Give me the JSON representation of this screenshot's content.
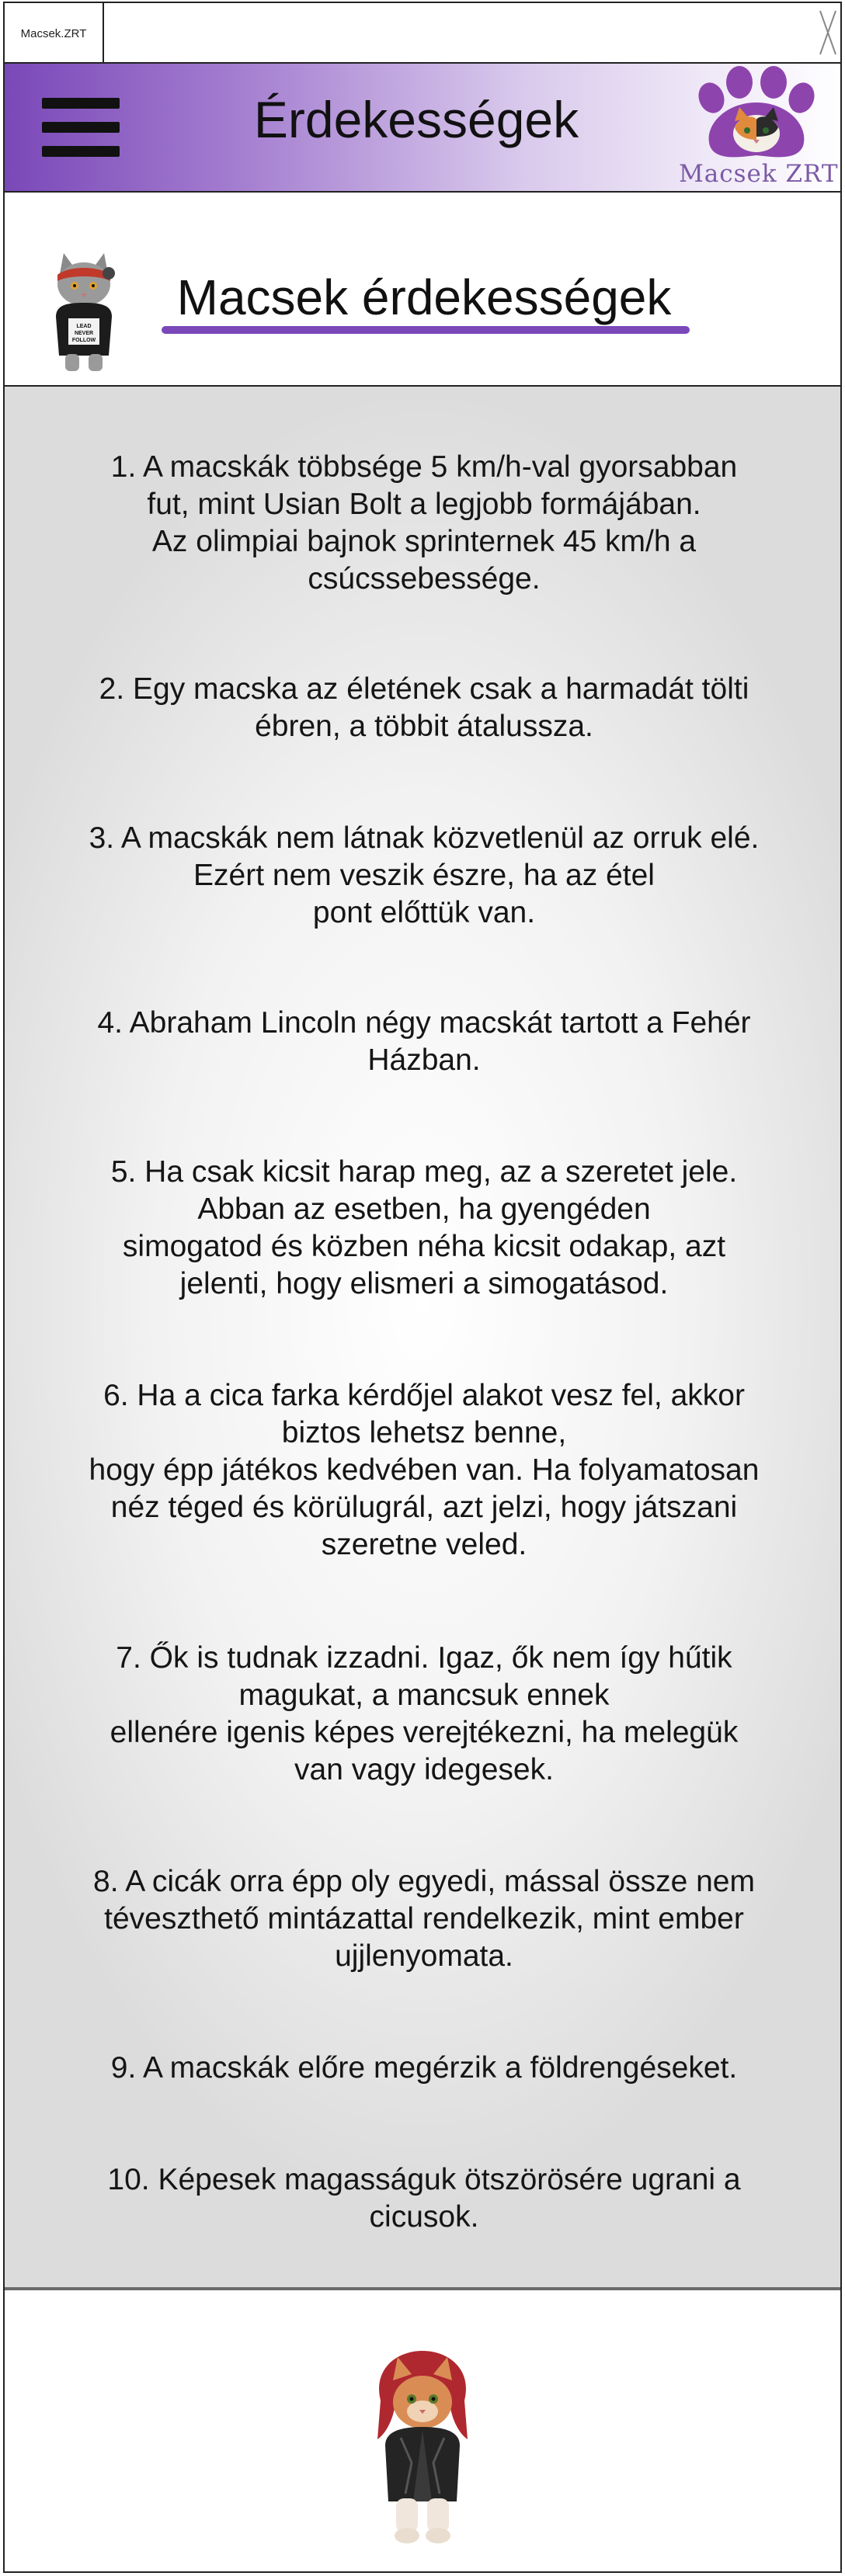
{
  "browser": {
    "tab_label": "Macsek.ZRT"
  },
  "header": {
    "title": "Érdekességek",
    "logo_text": "Macsek ZRT",
    "menu_icon": "hamburger-menu-icon",
    "accent": "#7a48b8"
  },
  "page": {
    "title": "Macsek érdekességek"
  },
  "facts": [
    "1. A macskák többsége 5 km/h-val gyorsabban\nfut, mint Usian Bolt a legjobb formájában.\nAz olimpiai bajnok sprinternek 45 km/h a\ncsúcssebessége.",
    "2. Egy macska az életének csak a harmadát tölti\nébren, a többit átalussza.",
    "3. A macskák nem látnak közvetlenül az orruk elé.\nEzért nem veszik észre, ha az étel\npont előttük van.",
    "4. Abraham Lincoln négy macskát tartott a Fehér\nHázban.",
    "5. Ha csak kicsit harap meg, az a szeretet jele.\nAbban az esetben, ha gyengéden\nsimogatod és közben néha kicsit odakap, azt\njelenti, hogy elismeri a simogatásod.",
    "6. Ha a cica farka kérdőjel alakot vesz fel, akkor\nbiztos lehetsz benne,\nhogy épp játékos kedvében van. Ha folyamatosan\nnéz téged és körülugrál, azt jelzi, hogy játszani\nszeretne veled.",
    "7. Ők is tudnak izzadni. Igaz, ők nem így hűtik\nmagukat, a mancsuk ennek\nellenére igenis képes verejtékezni, ha melegük\nvan vagy idegesek.",
    "8. A cicák orra épp oly egyedi, mással össze nem\ntéveszthető mintázattal rendelkezik, mint ember\nujjlenyomata.",
    "9. A macskák előre megérzik a földrengéseket.",
    "10. Képesek magasságuk ötszörösére ugrani a\ncicusok."
  ],
  "images": {
    "title_avatar": "cat-with-shirt-image",
    "footer_avatar": "cat-with-red-hair-image"
  }
}
